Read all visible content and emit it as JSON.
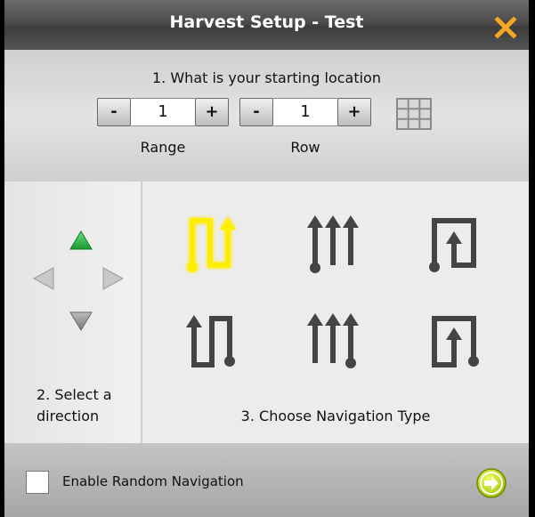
{
  "window": {
    "title": "Harvest Setup - Test",
    "close_icon": "close-x-icon",
    "accent_color": "#f5a623"
  },
  "location": {
    "question": "1. What is your starting location",
    "range": {
      "minus": "-",
      "value": "1",
      "plus": "+",
      "label": "Range"
    },
    "row": {
      "minus": "-",
      "value": "1",
      "plus": "+",
      "label": "Row"
    },
    "grid_icon": "grid-icon"
  },
  "direction": {
    "label_line1": "2. Select a",
    "label_line2": "direction",
    "arrows": [
      {
        "name": "up",
        "selected": true,
        "color": "#2eb84a"
      },
      {
        "name": "left",
        "selected": false,
        "color": "#bdbdbd"
      },
      {
        "name": "right",
        "selected": false,
        "color": "#bdbdbd"
      },
      {
        "name": "down",
        "selected": false,
        "color": "#9c9c9c"
      }
    ]
  },
  "navigation": {
    "label": "3. Choose Navigation Type",
    "selected_color": "#ffee00",
    "icon_color": "#444444",
    "types": [
      {
        "icon": "serpentine-icon",
        "selected": true
      },
      {
        "icon": "parallel-rows-icon",
        "selected": false
      },
      {
        "icon": "spiral-in-icon",
        "selected": false
      },
      {
        "icon": "serpentine-reverse-icon",
        "selected": false
      },
      {
        "icon": "parallel-rows-alt-icon",
        "selected": false
      },
      {
        "icon": "spiral-out-icon",
        "selected": false
      }
    ]
  },
  "footer": {
    "random_nav_label": "Enable Random Navigation",
    "random_nav_checked": false,
    "next_icon": "next-arrow-icon",
    "next_color": "#c6e000"
  }
}
